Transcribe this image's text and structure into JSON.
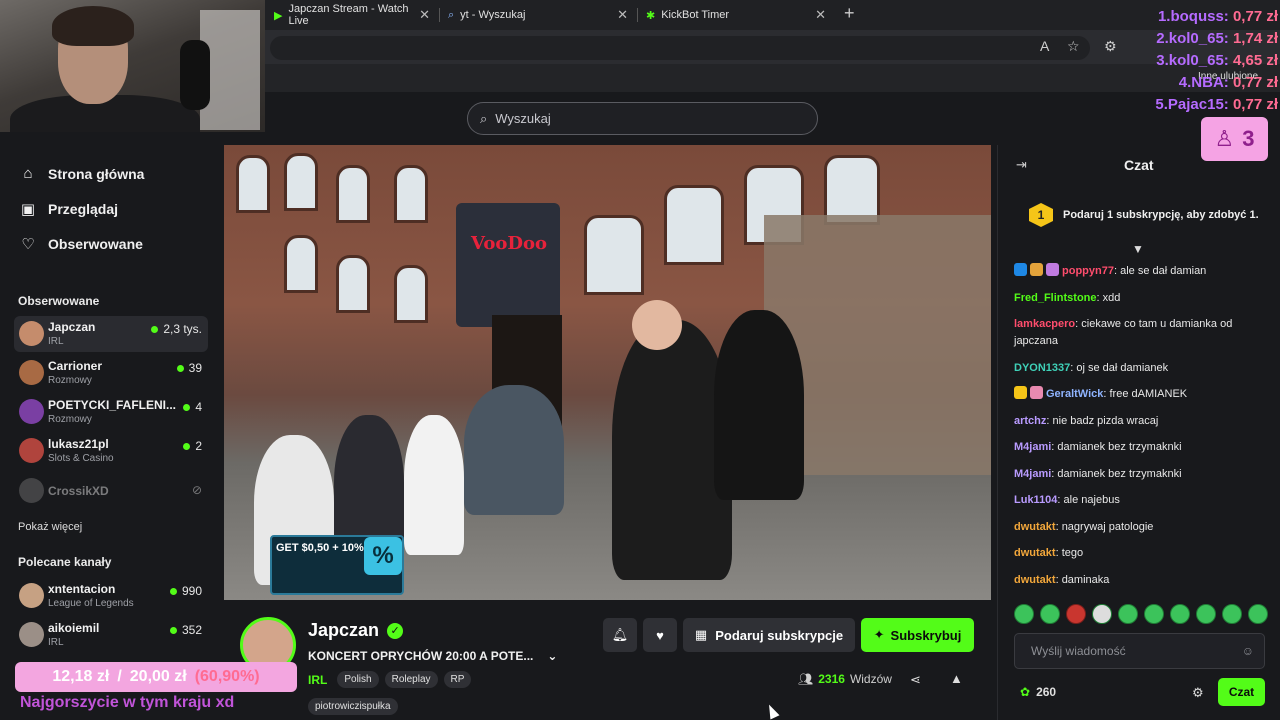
{
  "browser": {
    "tabs": [
      {
        "label": "Japczan Stream - Watch Live",
        "icon": "kick-icon"
      },
      {
        "label": "yt - Wyszukaj",
        "icon": "search-icon"
      },
      {
        "label": "KickBot Timer",
        "icon": "bot-icon"
      }
    ],
    "favorites_label": "Inne ulubione"
  },
  "header": {
    "search_placeholder": "Wyszukaj"
  },
  "sidebar": {
    "nav": [
      {
        "label": "Strona główna",
        "icon": "home-icon"
      },
      {
        "label": "Przeglądaj",
        "icon": "browse-icon"
      },
      {
        "label": "Obserwowane",
        "icon": "heart-icon"
      }
    ],
    "followed_title": "Obserwowane",
    "followed": [
      {
        "name": "Japczan",
        "category": "IRL",
        "viewers": "2,3 tys."
      },
      {
        "name": "Carrioner",
        "category": "Rozmowy",
        "viewers": "39"
      },
      {
        "name": "POETYCKI_FAFLENI...",
        "category": "Rozmowy",
        "viewers": "4"
      },
      {
        "name": "lukasz21pl",
        "category": "Slots & Casino",
        "viewers": "2"
      },
      {
        "name": "CrossikXD",
        "category": "",
        "viewers": ""
      }
    ],
    "show_more": "Pokaż więcej",
    "recommended_title": "Polecane kanały",
    "recommended": [
      {
        "name": "xntentacion",
        "category": "League of Legends",
        "viewers": "990"
      },
      {
        "name": "aikoiemil",
        "category": "IRL",
        "viewers": "352"
      }
    ]
  },
  "video": {
    "sign_text": "VooDoo",
    "ad_text": "GET $0,50 + 10%",
    "ad_symbol": "%"
  },
  "stream": {
    "streamer": "Japczan",
    "title": "KONCERT OPRYCHÓW 20:00 A POTE...",
    "category": "IRL",
    "tags": [
      "Polish",
      "Roleplay",
      "RP"
    ],
    "tag_extra": "piotrowiczispułka",
    "gift_label": "Podaruj subskrypcje",
    "subscribe_label": "Subskrybuj",
    "viewers_count": "2316",
    "viewers_label": "Widzów"
  },
  "chat": {
    "title": "Czat",
    "sub_banner": "Podaruj 1 subskrypcję, aby zdobyć 1.",
    "rank": "1",
    "messages": [
      {
        "user": "poppyn77",
        "color": "#ff4d6d",
        "text": "ale se dał damian",
        "badges": [
          "#1e88e5",
          "#e3a33b",
          "#c07be0"
        ]
      },
      {
        "user": "Fred_Flintstone",
        "color": "#53fc18",
        "text": "xdd",
        "badges": []
      },
      {
        "user": "lamkacpero",
        "color": "#ff4d6d",
        "text": "ciekawe co tam u damianka od japczana",
        "badges": []
      },
      {
        "user": "DYON1337",
        "color": "#3fd1b8",
        "text": "oj se dał damianek",
        "badges": []
      },
      {
        "user": "GeraltWick",
        "color": "#8fb4ff",
        "text": "free dAMIANEK",
        "badges": [
          "#f5c518",
          "#e88ab0"
        ]
      },
      {
        "user": "artchz",
        "color": "#b99bff",
        "text": "nie badz pizda wracaj",
        "badges": []
      },
      {
        "user": "M4jami",
        "color": "#b99bff",
        "text": "damianek bez trzymaknki",
        "badges": []
      },
      {
        "user": "M4jami",
        "color": "#b99bff",
        "text": "damianek bez trzymaknki",
        "badges": []
      },
      {
        "user": "Luk1104",
        "color": "#b99bff",
        "text": "ale najebus",
        "badges": []
      },
      {
        "user": "dwutakt",
        "color": "#f2a73b",
        "text": "nagrywaj patologie",
        "badges": []
      },
      {
        "user": "dwutakt",
        "color": "#f2a73b",
        "text": "tego",
        "badges": []
      },
      {
        "user": "dwutakt",
        "color": "#f2a73b",
        "text": "daminaka",
        "badges": []
      }
    ],
    "input_placeholder": "Wyślij wiadomość",
    "points": "260",
    "send_label": "Czat"
  },
  "overlays": {
    "leaderboard": [
      {
        "rank": "1.",
        "name": "boquss:",
        "amount": "0,77 zł"
      },
      {
        "rank": "2.",
        "name": "kol0_65:",
        "amount": "1,74 zł"
      },
      {
        "rank": "3.",
        "name": "kol0_65:",
        "amount": "4,65 zł"
      },
      {
        "rank": "4.",
        "name": "NBA:",
        "amount": "0,77 zł"
      },
      {
        "rank": "5.",
        "name": "Pajac15:",
        "amount": "0,77 zł"
      }
    ],
    "viewer_count": "3",
    "donation_current": "12,18 zł",
    "donation_separator": "/",
    "donation_goal": "20,00 zł",
    "donation_percent": "(60,90%)",
    "donation_message": "Najgorszycie w tym kraju xd"
  }
}
